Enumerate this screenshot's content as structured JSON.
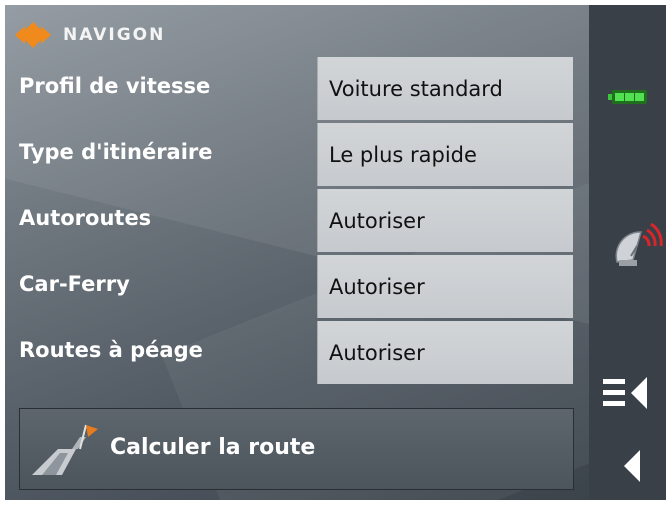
{
  "header": {
    "brand": "NAVIGON"
  },
  "settings": [
    {
      "label": "Profil de vitesse",
      "value": "Voiture standard"
    },
    {
      "label": "Type d'itinéraire",
      "value": "Le plus rapide"
    },
    {
      "label": "Autoroutes",
      "value": "Autoriser"
    },
    {
      "label": "Car-Ferry",
      "value": "Autoriser"
    },
    {
      "label": "Routes à péage",
      "value": "Autoriser"
    }
  ],
  "actions": {
    "calculate_label": "Calculer la route"
  },
  "sidebar": {
    "icons": [
      "battery-icon",
      "gps-satellite-icon",
      "menu-back-icon",
      "back-arrow-icon"
    ]
  },
  "colors": {
    "brand_orange": "#f08a1c",
    "battery_green": "#3cc43c",
    "gps_red": "#d8262a",
    "value_box": "#c9cdd1",
    "sidebar": "#3a4048"
  }
}
